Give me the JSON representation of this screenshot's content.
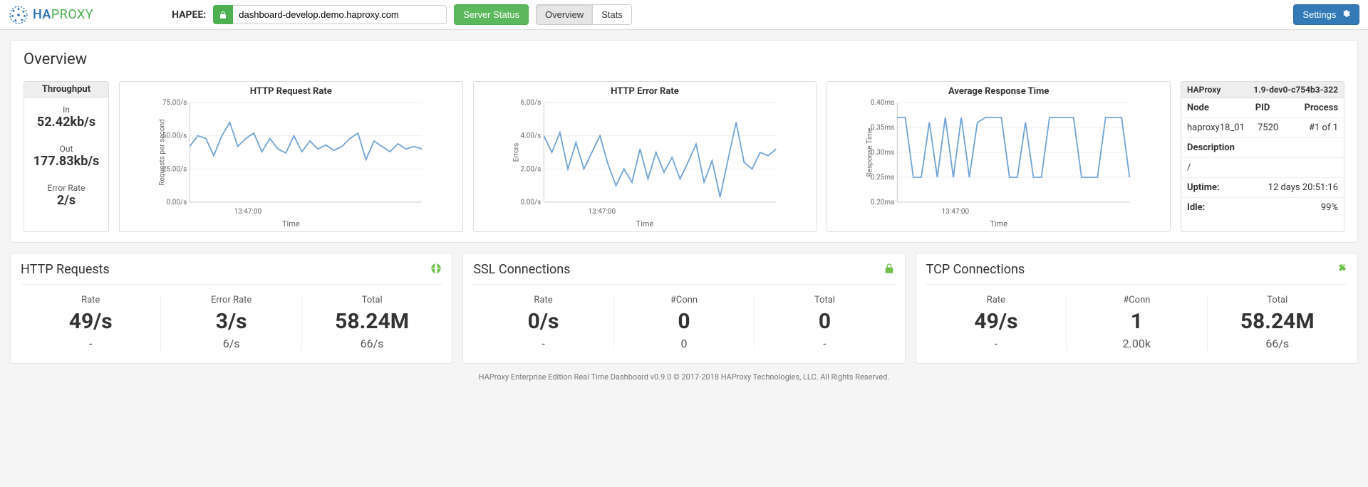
{
  "header": {
    "logo_text_strong": "HA",
    "logo_text_light": "PROXY",
    "hapee_label": "HAPEE:",
    "url": "dashboard-develop.demo.haproxy.com",
    "server_status_btn": "Server Status",
    "tabs": {
      "overview": "Overview",
      "stats": "Stats"
    },
    "settings_btn": "Settings"
  },
  "overview": {
    "title": "Overview",
    "throughput": {
      "header": "Throughput",
      "in_label": "In",
      "in_value": "52.42kb/s",
      "out_label": "Out",
      "out_value": "177.83kb/s",
      "errrate_label": "Error Rate",
      "errrate_value": "2/s"
    },
    "info": {
      "name": "HAProxy",
      "version": "1.9-dev0-c754b3-322",
      "cols": {
        "node": "Node",
        "pid": "PID",
        "process": "Process"
      },
      "node": "haproxy18_01",
      "pid": "7520",
      "process": "#1 of 1",
      "desc_label": "Description",
      "desc_value": "/",
      "uptime_label": "Uptime:",
      "uptime_value": "12 days 20:51:16",
      "idle_label": "Idle:",
      "idle_value": "99%"
    }
  },
  "charts": {
    "req": {
      "title": "HTTP Request Rate",
      "ylabel": "Requests per second",
      "xlabel": "Time",
      "yticks": [
        "0.00/s",
        "25.00/s",
        "50.00/s",
        "75.00/s"
      ],
      "xtick": "13:47:00"
    },
    "err": {
      "title": "HTTP Error Rate",
      "ylabel": "Errors",
      "xlabel": "Time",
      "yticks": [
        "0.00/s",
        "2.00/s",
        "4.00/s",
        "6.00/s"
      ],
      "xtick": "13:47:00"
    },
    "resp": {
      "title": "Average Response Time",
      "ylabel": "Response Time",
      "xlabel": "Time",
      "yticks": [
        "0.20ms",
        "0.25ms",
        "0.30ms",
        "0.35ms",
        "0.40ms"
      ],
      "xtick": "13:47:00"
    }
  },
  "chart_data": [
    {
      "type": "line",
      "title": "HTTP Request Rate",
      "ylabel": "Requests per second",
      "xlabel": "Time",
      "ylim": [
        0,
        75
      ],
      "xtick": "13:47:00",
      "values": [
        42,
        50,
        48,
        35,
        50,
        60,
        42,
        48,
        52,
        38,
        48,
        40,
        37,
        50,
        38,
        46,
        40,
        43,
        39,
        42,
        48,
        52,
        32,
        46,
        42,
        38,
        44,
        40,
        42,
        40
      ]
    },
    {
      "type": "line",
      "title": "HTTP Error Rate",
      "ylabel": "Errors",
      "xlabel": "Time",
      "ylim": [
        0,
        6
      ],
      "xtick": "13:47:00",
      "values": [
        4.0,
        3.0,
        4.2,
        2.0,
        3.6,
        2.0,
        3.0,
        4.0,
        2.3,
        1.0,
        2.0,
        1.2,
        3.2,
        1.4,
        3.0,
        1.8,
        2.7,
        1.4,
        2.4,
        3.5,
        1.2,
        2.5,
        0.3,
        2.6,
        4.8,
        2.4,
        2.0,
        3.0,
        2.8,
        3.2
      ]
    },
    {
      "type": "line",
      "title": "Average Response Time",
      "ylabel": "Response Time",
      "xlabel": "Time",
      "ylim": [
        0.2,
        0.4
      ],
      "xtick": "13:47:00",
      "values": [
        0.37,
        0.37,
        0.25,
        0.25,
        0.36,
        0.25,
        0.37,
        0.25,
        0.37,
        0.25,
        0.36,
        0.37,
        0.37,
        0.37,
        0.25,
        0.25,
        0.36,
        0.25,
        0.25,
        0.37,
        0.37,
        0.37,
        0.37,
        0.25,
        0.25,
        0.25,
        0.37,
        0.37,
        0.37,
        0.25
      ]
    }
  ],
  "cards": {
    "http": {
      "title": "HTTP Requests",
      "metrics": [
        {
          "label": "Rate",
          "value": "49/s",
          "sub": "-"
        },
        {
          "label": "Error Rate",
          "value": "3/s",
          "sub": "6/s"
        },
        {
          "label": "Total",
          "value": "58.24M",
          "sub": "66/s"
        }
      ]
    },
    "ssl": {
      "title": "SSL Connections",
      "metrics": [
        {
          "label": "Rate",
          "value": "0/s",
          "sub": "-"
        },
        {
          "label": "#Conn",
          "value": "0",
          "sub": "0"
        },
        {
          "label": "Total",
          "value": "0",
          "sub": "-"
        }
      ]
    },
    "tcp": {
      "title": "TCP Connections",
      "metrics": [
        {
          "label": "Rate",
          "value": "49/s",
          "sub": "-"
        },
        {
          "label": "#Conn",
          "value": "1",
          "sub": "2.00k"
        },
        {
          "label": "Total",
          "value": "58.24M",
          "sub": "66/s"
        }
      ]
    }
  },
  "footer": "HAProxy Enterprise Edition Real Time Dashboard v0.9.0 © 2017-2018 HAProxy Technologies, LLC. All Rights Reserved."
}
